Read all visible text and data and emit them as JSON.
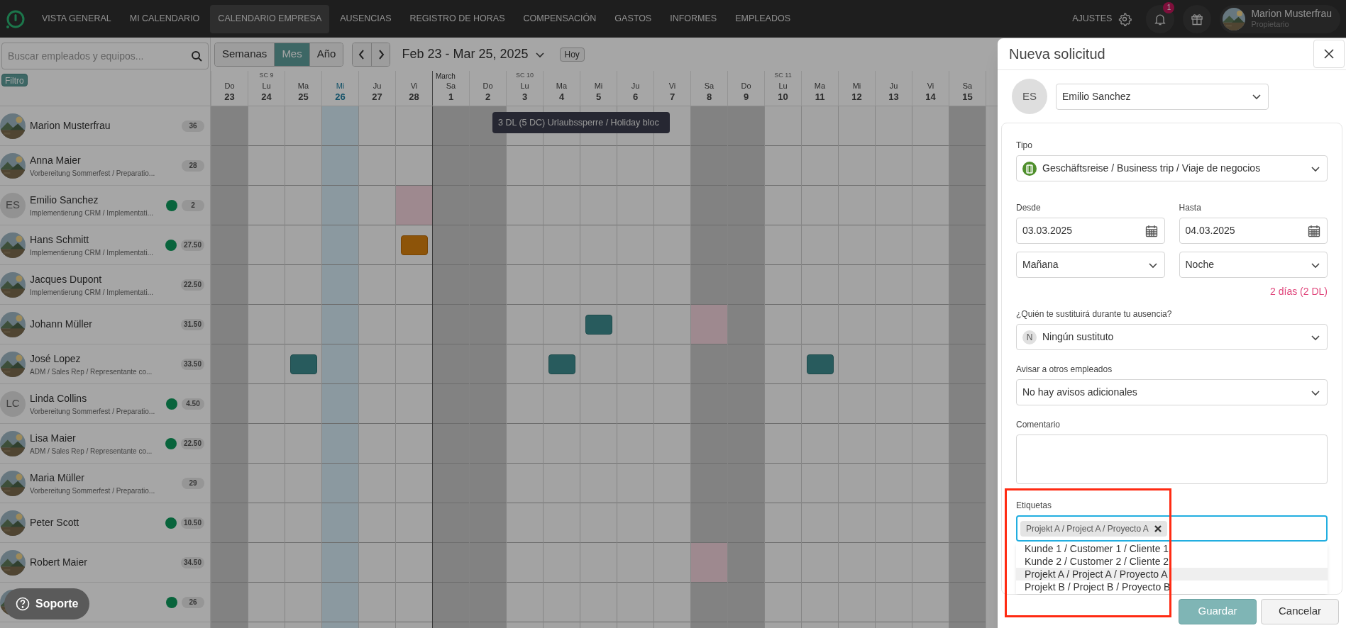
{
  "nav": {
    "items": [
      {
        "label": "VISTA GENERAL",
        "selected": false
      },
      {
        "label": "MI CALENDARIO",
        "selected": false
      },
      {
        "label": "CALENDARIO EMPRESA",
        "selected": true
      },
      {
        "label": "AUSENCIAS",
        "selected": false
      },
      {
        "label": "REGISTRO DE HORAS",
        "selected": false
      },
      {
        "label": "COMPENSACIÓN",
        "selected": false
      },
      {
        "label": "GASTOS",
        "selected": false
      },
      {
        "label": "INFORMES",
        "selected": false
      },
      {
        "label": "EMPLEADOS",
        "selected": false
      }
    ],
    "settings": "AJUSTES",
    "notifications": "1",
    "user": {
      "name": "Marion Musterfrau",
      "role": "Propietario"
    }
  },
  "sidebar": {
    "search": {
      "placeholder": "Buscar empleados y equipos..."
    },
    "filter": "Filtro"
  },
  "toolbar": {
    "views": [
      {
        "label": "Semanas",
        "selected": false
      },
      {
        "label": "Mes",
        "selected": true
      },
      {
        "label": "Año",
        "selected": false
      }
    ],
    "range": "Feb 23 - Mar 25, 2025",
    "today": "Hoy"
  },
  "days": [
    {
      "weekday": "Do",
      "day": "23",
      "weekend": true,
      "today": false
    },
    {
      "weekday": "Lu",
      "day": "24",
      "weekend": false,
      "today": false,
      "week": "SC 9"
    },
    {
      "weekday": "Ma",
      "day": "25",
      "weekend": false,
      "today": false
    },
    {
      "weekday": "Mi",
      "day": "26",
      "weekend": false,
      "today": true
    },
    {
      "weekday": "Ju",
      "day": "27",
      "weekend": false,
      "today": false
    },
    {
      "weekday": "Vi",
      "day": "28",
      "weekend": false,
      "today": false
    },
    {
      "weekday": "Sa",
      "day": "1",
      "weekend": true,
      "today": false,
      "month": "March"
    },
    {
      "weekday": "Do",
      "day": "2",
      "weekend": true,
      "today": false
    },
    {
      "weekday": "Lu",
      "day": "3",
      "weekend": false,
      "today": false,
      "week": "SC 10"
    },
    {
      "weekday": "Ma",
      "day": "4",
      "weekend": false,
      "today": false
    },
    {
      "weekday": "Mi",
      "day": "5",
      "weekend": false,
      "today": false
    },
    {
      "weekday": "Ju",
      "day": "6",
      "weekend": false,
      "today": false
    },
    {
      "weekday": "Vi",
      "day": "7",
      "weekend": false,
      "today": false
    },
    {
      "weekday": "Sa",
      "day": "8",
      "weekend": true,
      "today": false
    },
    {
      "weekday": "Do",
      "day": "9",
      "weekend": true,
      "today": false
    },
    {
      "weekday": "Lu",
      "day": "10",
      "weekend": false,
      "today": false,
      "week": "SC 11"
    },
    {
      "weekday": "Ma",
      "day": "11",
      "weekend": false,
      "today": false
    },
    {
      "weekday": "Mi",
      "day": "12",
      "weekend": false,
      "today": false
    },
    {
      "weekday": "Ju",
      "day": "13",
      "weekend": false,
      "today": false
    },
    {
      "weekday": "Vi",
      "day": "14",
      "weekend": false,
      "today": false
    },
    {
      "weekday": "Sa",
      "day": "15",
      "weekend": true,
      "today": false
    }
  ],
  "employees": [
    {
      "name": "Marion Musterfrau",
      "online": false,
      "hours": "36",
      "cells": [
        {
          "kind": "free"
        },
        {
          "kind": "free"
        },
        {
          "kind": "free"
        },
        {
          "kind": "free"
        },
        {
          "kind": "free"
        },
        {
          "kind": "free"
        },
        {
          "kind": "free"
        },
        {
          "kind": "free"
        },
        {
          "kind": "free"
        },
        {
          "kind": "free"
        },
        {
          "kind": "free"
        },
        {
          "kind": "free"
        },
        {
          "kind": "free"
        },
        {
          "kind": "free"
        },
        {
          "kind": "free"
        },
        {
          "kind": "free"
        },
        {
          "kind": "free"
        },
        {
          "kind": "free"
        },
        {
          "kind": "free"
        },
        {
          "kind": "free"
        },
        {
          "kind": "free"
        }
      ]
    },
    {
      "name": "Anna Maier",
      "subtitle": "Vorbereitung Sommerfest / Preparatio...",
      "online": false,
      "hours": "28",
      "cells": [
        {
          "kind": "free"
        },
        {
          "kind": "free"
        },
        {
          "kind": "free"
        },
        {
          "kind": "free"
        },
        {
          "kind": "free"
        },
        {
          "kind": "free"
        },
        {
          "kind": "free"
        },
        {
          "kind": "free"
        },
        {
          "kind": "free"
        },
        {
          "kind": "free"
        },
        {
          "kind": "free"
        },
        {
          "kind": "free"
        },
        {
          "kind": "free"
        },
        {
          "kind": "free"
        },
        {
          "kind": "free"
        },
        {
          "kind": "free"
        },
        {
          "kind": "free"
        },
        {
          "kind": "free"
        },
        {
          "kind": "free"
        },
        {
          "kind": "free"
        },
        {
          "kind": "free"
        }
      ]
    },
    {
      "name": "Emilio Sanchez",
      "subtitle": "Implementierung CRM / Implementati...",
      "avatar": {
        "kind": "initials",
        "initials": "ES"
      },
      "online": true,
      "hours": "2",
      "cells": [
        {
          "kind": "free"
        },
        {
          "kind": "free"
        },
        {
          "kind": "free"
        },
        {
          "kind": "free"
        },
        {
          "kind": "free"
        },
        {
          "kind": "blocked"
        },
        {
          "kind": "free"
        },
        {
          "kind": "free"
        },
        {
          "kind": "free"
        },
        {
          "kind": "free"
        },
        {
          "kind": "free"
        },
        {
          "kind": "free"
        },
        {
          "kind": "free"
        },
        {
          "kind": "free"
        },
        {
          "kind": "free"
        },
        {
          "kind": "free"
        },
        {
          "kind": "free"
        },
        {
          "kind": "free"
        },
        {
          "kind": "free"
        },
        {
          "kind": "free"
        },
        {
          "kind": "free"
        }
      ]
    },
    {
      "name": "Hans Schmitt",
      "subtitle": "Implementierung CRM / Implementati...",
      "online": true,
      "hours": "27.50",
      "cells": [
        {
          "kind": "free"
        },
        {
          "kind": "free"
        },
        {
          "kind": "free"
        },
        {
          "kind": "free"
        },
        {
          "kind": "free"
        },
        {
          "kind": "absence"
        },
        {
          "kind": "free"
        },
        {
          "kind": "free"
        },
        {
          "kind": "free"
        },
        {
          "kind": "free"
        },
        {
          "kind": "free"
        },
        {
          "kind": "free"
        },
        {
          "kind": "free"
        },
        {
          "kind": "free"
        },
        {
          "kind": "free"
        },
        {
          "kind": "free"
        },
        {
          "kind": "free"
        },
        {
          "kind": "free"
        },
        {
          "kind": "free"
        },
        {
          "kind": "free"
        },
        {
          "kind": "free"
        }
      ]
    },
    {
      "name": "Jacques Dupont",
      "subtitle": "Implementierung CRM / Implementati...",
      "online": false,
      "hours": "22.50",
      "cells": [
        {
          "kind": "free"
        },
        {
          "kind": "free"
        },
        {
          "kind": "free"
        },
        {
          "kind": "free"
        },
        {
          "kind": "free"
        },
        {
          "kind": "free"
        },
        {
          "kind": "free"
        },
        {
          "kind": "free"
        },
        {
          "kind": "free"
        },
        {
          "kind": "free"
        },
        {
          "kind": "free"
        },
        {
          "kind": "free"
        },
        {
          "kind": "free"
        },
        {
          "kind": "free"
        },
        {
          "kind": "free"
        },
        {
          "kind": "free"
        },
        {
          "kind": "free"
        },
        {
          "kind": "free"
        },
        {
          "kind": "free"
        },
        {
          "kind": "free"
        },
        {
          "kind": "free"
        }
      ]
    },
    {
      "name": "Johann Müller",
      "online": false,
      "hours": "31.50",
      "cells": [
        {
          "kind": "free"
        },
        {
          "kind": "free"
        },
        {
          "kind": "free"
        },
        {
          "kind": "free"
        },
        {
          "kind": "free"
        },
        {
          "kind": "free"
        },
        {
          "kind": "free"
        },
        {
          "kind": "free"
        },
        {
          "kind": "free"
        },
        {
          "kind": "free"
        },
        {
          "kind": "trip"
        },
        {
          "kind": "free"
        },
        {
          "kind": "free"
        },
        {
          "kind": "blocked"
        },
        {
          "kind": "free"
        },
        {
          "kind": "free"
        },
        {
          "kind": "free"
        },
        {
          "kind": "free"
        },
        {
          "kind": "free"
        },
        {
          "kind": "free"
        },
        {
          "kind": "free"
        }
      ]
    },
    {
      "name": "José Lopez",
      "subtitle": "ADM / Sales Rep / Representante co...",
      "online": false,
      "hours": "33.50",
      "cells": [
        {
          "kind": "free"
        },
        {
          "kind": "free"
        },
        {
          "kind": "trip"
        },
        {
          "kind": "free"
        },
        {
          "kind": "free"
        },
        {
          "kind": "free"
        },
        {
          "kind": "free"
        },
        {
          "kind": "free"
        },
        {
          "kind": "free"
        },
        {
          "kind": "trip"
        },
        {
          "kind": "free"
        },
        {
          "kind": "free"
        },
        {
          "kind": "free"
        },
        {
          "kind": "free"
        },
        {
          "kind": "free"
        },
        {
          "kind": "free"
        },
        {
          "kind": "trip"
        },
        {
          "kind": "free"
        },
        {
          "kind": "free"
        },
        {
          "kind": "free"
        },
        {
          "kind": "free"
        }
      ]
    },
    {
      "name": "Linda Collins",
      "subtitle": "Vorbereitung Sommerfest / Preparatio...",
      "avatar": {
        "kind": "initials",
        "initials": "LC"
      },
      "online": true,
      "hours": "4.50",
      "cells": [
        {
          "kind": "free"
        },
        {
          "kind": "free"
        },
        {
          "kind": "free"
        },
        {
          "kind": "free"
        },
        {
          "kind": "free"
        },
        {
          "kind": "free"
        },
        {
          "kind": "free"
        },
        {
          "kind": "free"
        },
        {
          "kind": "free"
        },
        {
          "kind": "free"
        },
        {
          "kind": "free"
        },
        {
          "kind": "free"
        },
        {
          "kind": "free"
        },
        {
          "kind": "free"
        },
        {
          "kind": "free"
        },
        {
          "kind": "free"
        },
        {
          "kind": "free"
        },
        {
          "kind": "free"
        },
        {
          "kind": "free"
        },
        {
          "kind": "free"
        },
        {
          "kind": "free"
        }
      ]
    },
    {
      "name": "Lisa Maier",
      "subtitle": "ADM / Sales Rep / Representante co...",
      "online": true,
      "hours": "22.50",
      "cells": [
        {
          "kind": "free"
        },
        {
          "kind": "free"
        },
        {
          "kind": "free"
        },
        {
          "kind": "free"
        },
        {
          "kind": "free"
        },
        {
          "kind": "free"
        },
        {
          "kind": "free"
        },
        {
          "kind": "free"
        },
        {
          "kind": "free"
        },
        {
          "kind": "free"
        },
        {
          "kind": "free"
        },
        {
          "kind": "free"
        },
        {
          "kind": "free"
        },
        {
          "kind": "free"
        },
        {
          "kind": "free"
        },
        {
          "kind": "free"
        },
        {
          "kind": "free"
        },
        {
          "kind": "free"
        },
        {
          "kind": "free"
        },
        {
          "kind": "free"
        },
        {
          "kind": "free"
        }
      ]
    },
    {
      "name": "Maria Müller",
      "subtitle": "Vorbereitung Sommerfest / Preparatio...",
      "online": false,
      "hours": "29",
      "cells": [
        {
          "kind": "free"
        },
        {
          "kind": "free"
        },
        {
          "kind": "free"
        },
        {
          "kind": "free"
        },
        {
          "kind": "free"
        },
        {
          "kind": "free"
        },
        {
          "kind": "free"
        },
        {
          "kind": "free"
        },
        {
          "kind": "free"
        },
        {
          "kind": "free"
        },
        {
          "kind": "free"
        },
        {
          "kind": "free"
        },
        {
          "kind": "free"
        },
        {
          "kind": "free"
        },
        {
          "kind": "free"
        },
        {
          "kind": "free"
        },
        {
          "kind": "free"
        },
        {
          "kind": "free"
        },
        {
          "kind": "free"
        },
        {
          "kind": "free"
        },
        {
          "kind": "free"
        }
      ]
    },
    {
      "name": "Peter Scott",
      "online": true,
      "hours": "10.50",
      "cells": [
        {
          "kind": "free"
        },
        {
          "kind": "free"
        },
        {
          "kind": "free"
        },
        {
          "kind": "free"
        },
        {
          "kind": "free"
        },
        {
          "kind": "free"
        },
        {
          "kind": "free"
        },
        {
          "kind": "free"
        },
        {
          "kind": "free"
        },
        {
          "kind": "free"
        },
        {
          "kind": "free"
        },
        {
          "kind": "free"
        },
        {
          "kind": "free"
        },
        {
          "kind": "free"
        },
        {
          "kind": "free"
        },
        {
          "kind": "free"
        },
        {
          "kind": "free"
        },
        {
          "kind": "free"
        },
        {
          "kind": "free"
        },
        {
          "kind": "free"
        },
        {
          "kind": "free"
        }
      ]
    },
    {
      "name": "Robert Maier",
      "online": false,
      "hours": "34.50",
      "cells": [
        {
          "kind": "free"
        },
        {
          "kind": "free"
        },
        {
          "kind": "free"
        },
        {
          "kind": "free"
        },
        {
          "kind": "free"
        },
        {
          "kind": "free"
        },
        {
          "kind": "free"
        },
        {
          "kind": "free"
        },
        {
          "kind": "free"
        },
        {
          "kind": "free"
        },
        {
          "kind": "free"
        },
        {
          "kind": "free"
        },
        {
          "kind": "free"
        },
        {
          "kind": "blocked"
        },
        {
          "kind": "free"
        },
        {
          "kind": "free"
        },
        {
          "kind": "free"
        },
        {
          "kind": "free"
        },
        {
          "kind": "free"
        },
        {
          "kind": "free"
        },
        {
          "kind": "free"
        }
      ]
    },
    {
      "online": true,
      "hours": "26",
      "cells": [
        {
          "kind": "free"
        },
        {
          "kind": "free"
        },
        {
          "kind": "free"
        },
        {
          "kind": "free"
        },
        {
          "kind": "free"
        },
        {
          "kind": "free"
        },
        {
          "kind": "free"
        },
        {
          "kind": "free"
        },
        {
          "kind": "free"
        },
        {
          "kind": "free"
        },
        {
          "kind": "free"
        },
        {
          "kind": "free"
        },
        {
          "kind": "free"
        },
        {
          "kind": "free"
        },
        {
          "kind": "free"
        },
        {
          "kind": "free"
        },
        {
          "kind": "free"
        },
        {
          "kind": "free"
        },
        {
          "kind": "free"
        },
        {
          "kind": "free"
        },
        {
          "kind": "free"
        }
      ]
    }
  ],
  "tooltip": "3 DL (5 DC) Urlaubssperre / Holiday bloc",
  "support": "Soporte",
  "panel": {
    "title": "Nueva solicitud",
    "employee": {
      "initials": "ES",
      "name": "Emilio Sanchez"
    },
    "type": {
      "label": "Tipo",
      "value": "Geschäftsreise / Business trip / Viaje de negocios"
    },
    "from": {
      "label": "Desde",
      "date": "03.03.2025",
      "part": "Mañana"
    },
    "to": {
      "label": "Hasta",
      "date": "04.03.2025",
      "part": "Noche"
    },
    "duration": "2 días (2 DL)",
    "substitute": {
      "label": "¿Quién te sustituirá durante tu ausencia?",
      "initial": "N",
      "value": "Ningún sustituto"
    },
    "notify": {
      "label": "Avisar a otros empleados",
      "value": "No hay avisos adicionales"
    },
    "comment": {
      "label": "Comentario"
    },
    "tags": {
      "label": "Etiquetas",
      "chips": [
        "Projekt A / Project A / Proyecto A"
      ],
      "options": [
        {
          "label": "Kunde 1 / Customer 1 / Cliente 1",
          "selected": false
        },
        {
          "label": "Kunde 2 / Customer 2 / Cliente 2",
          "selected": false
        },
        {
          "label": "Projekt A / Project A / Proyecto A",
          "selected": true
        },
        {
          "label": "Projekt B / Project B / Proyecto B",
          "selected": false
        }
      ]
    },
    "save": "Guardar",
    "cancel": "Cancelar"
  },
  "annotation_frame": true
}
